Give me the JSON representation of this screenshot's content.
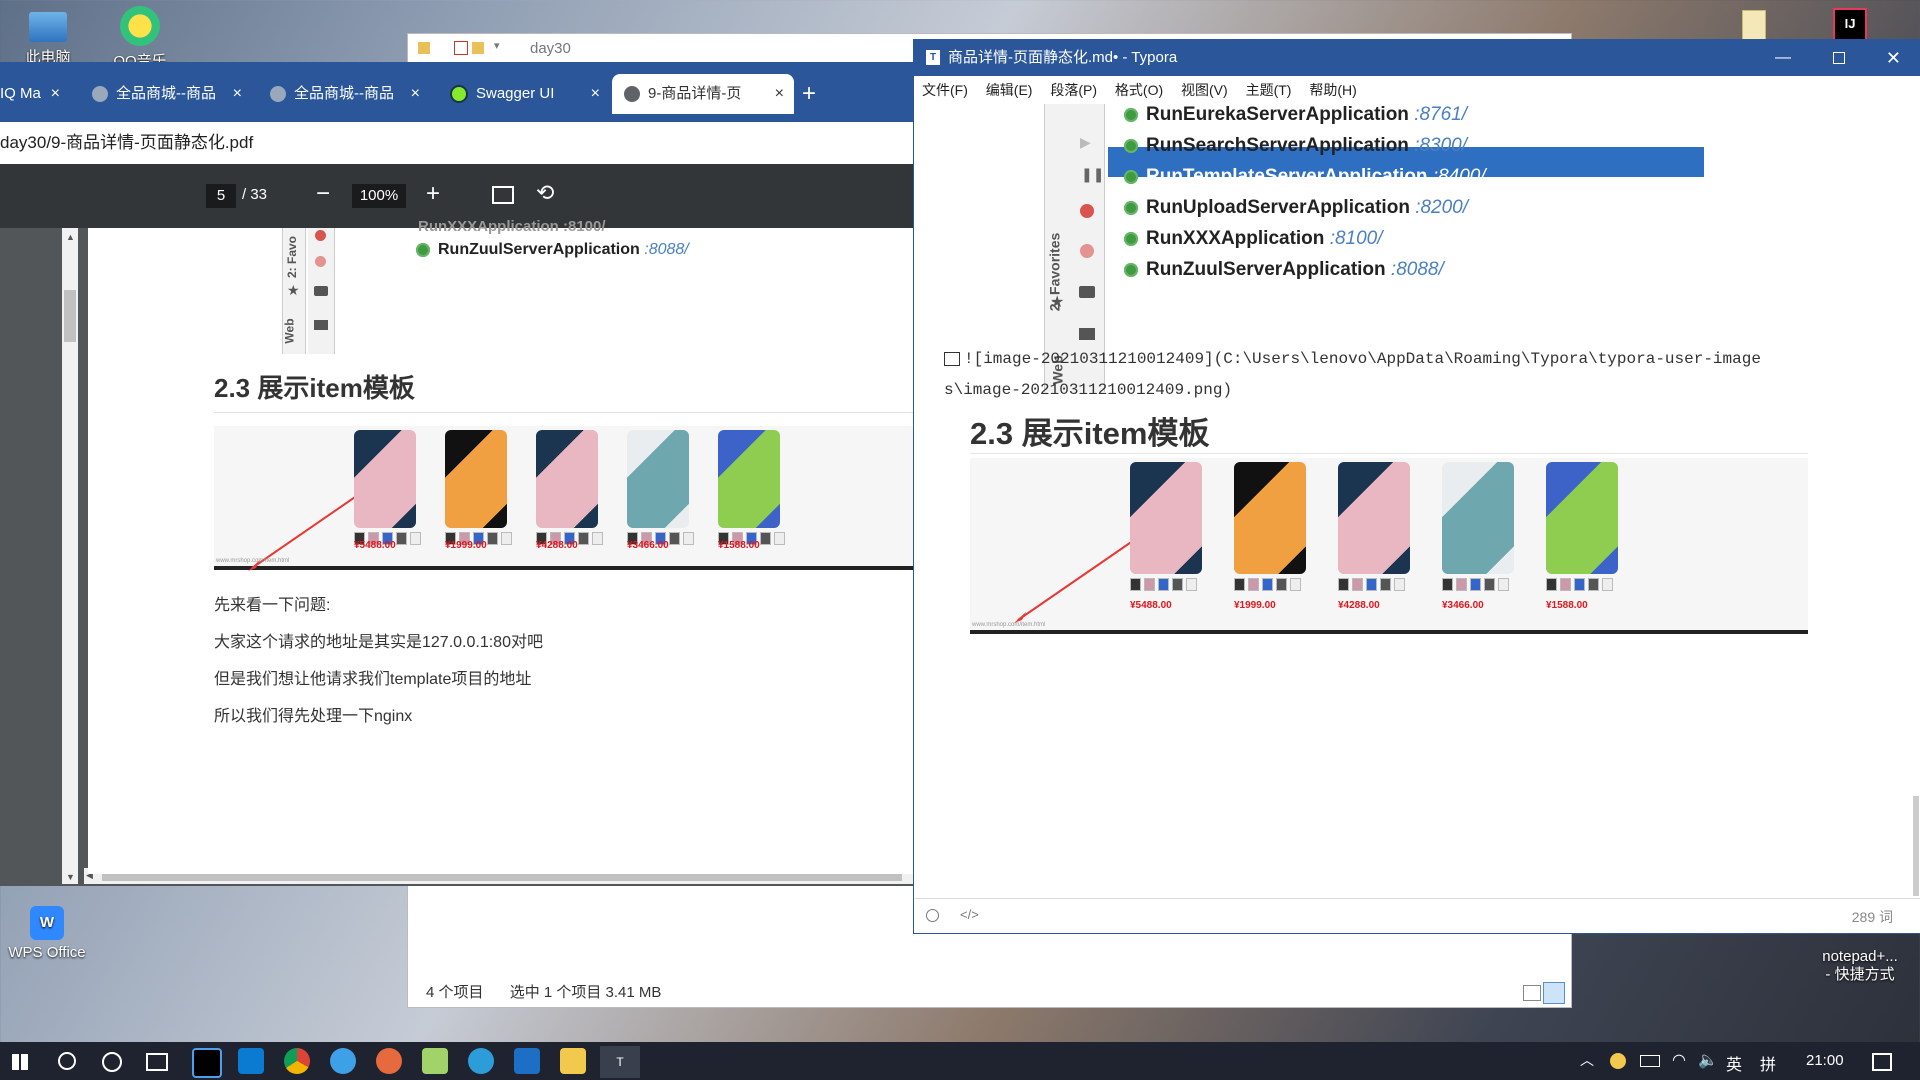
{
  "desktop": {
    "icons": [
      {
        "label": "此电脑"
      },
      {
        "label": "QQ音乐"
      },
      {
        "label": "WPS Office"
      },
      {
        "label": "notepad+...\n- 快捷方式"
      }
    ]
  },
  "explorer": {
    "address": "day30",
    "status_count": "4 个项目",
    "status_selected": "选中 1 个项目  3.41 MB"
  },
  "browser": {
    "tabs": [
      {
        "label": "IQ Ma"
      },
      {
        "label": "全品商城--商品"
      },
      {
        "label": "全品商城--商品"
      },
      {
        "label": "Swagger UI"
      },
      {
        "label": "9-商品详情-页"
      }
    ],
    "new_tab": "+",
    "url": "day30/9-商品详情-页面静态化.pdf",
    "pdf": {
      "page_current": "5",
      "page_total": "/ 33",
      "zoom": "100%",
      "run_items_partial": "RunXXXApplication :8100/",
      "run_item_last": {
        "name": "RunZuulServerApplication",
        "port": ":8088/"
      },
      "side_labels": [
        "2: Favo",
        "Web"
      ],
      "heading": "2.3 展示item模板",
      "url_caption": "www.mrshop.com/item.html",
      "prices": [
        "¥5488.00",
        "¥1999.00",
        "¥4288.00",
        "¥3466.00",
        "¥1588.00"
      ],
      "paragraphs": [
        "先来看一下问题:",
        "大家这个请求的地址是其实是127.0.0.1:80对吧",
        "但是我们想让他请求我们template项目的地址",
        "所以我们得先处理一下nginx"
      ]
    }
  },
  "typora": {
    "title": "商品详情-页面静态化.md• - Typora",
    "menu": [
      "文件(F)",
      "编辑(E)",
      "段落(P)",
      "格式(O)",
      "视图(V)",
      "主题(T)",
      "帮助(H)"
    ],
    "run_items": [
      {
        "name": "RunEurekaServerApplication",
        "port": ":8761/"
      },
      {
        "name": "RunSearchServerApplication",
        "port": ":8300/"
      },
      {
        "name": "RunTemplateServerApplication",
        "port": ":8400/"
      },
      {
        "name": "RunUploadServerApplication",
        "port": ":8200/"
      },
      {
        "name": "RunXXXApplication",
        "port": ":8100/"
      },
      {
        "name": "RunZuulServerApplication",
        "port": ":8088/"
      }
    ],
    "side_labels": [
      "2: Favorites",
      "Web"
    ],
    "image_md_line1": "![image-20210311210012409](C:\\Users\\lenovo\\AppData\\Roaming\\Typora\\typora-user-image",
    "image_md_line2": "s\\image-20210311210012409.png)",
    "heading": "2.3 展示item模板",
    "url_caption": "www.mrshop.com/item.html",
    "prices": [
      "¥5488.00",
      "¥1999.00",
      "¥4288.00",
      "¥3466.00",
      "¥1588.00"
    ],
    "word_count": "289 词"
  },
  "taskbar": {
    "time": "21:00",
    "ime_lang": "英",
    "ime_mode": "拼"
  },
  "colors": {
    "accent": "#2b579a",
    "selection": "#2f6fc2",
    "price_red": "#e0161c",
    "port_blue": "#4a7fc1"
  }
}
